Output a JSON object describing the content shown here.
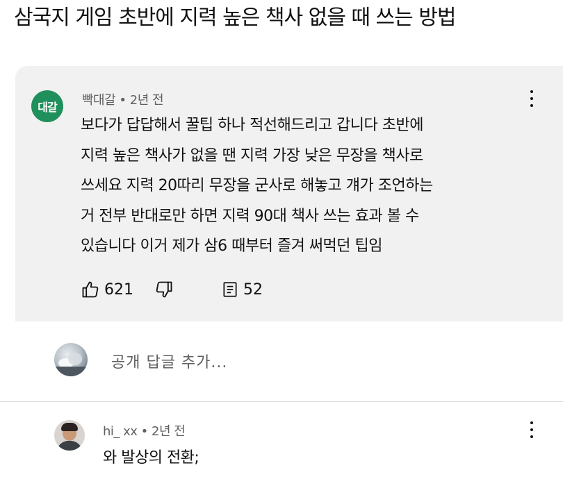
{
  "post": {
    "title": "삼국지 게임 초반에 지력 높은 책사 없을 때 쓰는 방법"
  },
  "comment": {
    "avatar_text": "대갈",
    "author": "빡대갈",
    "separator": " • ",
    "time": "2년 전",
    "body_lines": [
      "보다가 답답해서 꿀팁 하나 적선해드리고 갑니다 초반에",
      "지력 높은 책사가 없을 땐 지력 가장 낮은 무장을 책사로",
      "쓰세요 지력 20따리 무장을 군사로 해놓고 걔가 조언하는",
      "거 전부 반대로만 하면 지력 90대 책사 쓰는 효과 볼 수",
      "있습니다 이거 제가 삼6 때부터 즐겨 써먹던 팁임"
    ],
    "likes": "621",
    "replies": "52",
    "avatar_color": "#1f8f5c"
  },
  "reply_box": {
    "placeholder": "공개 답글 추가..."
  },
  "reply": {
    "author": "hi_ xx",
    "separator": " • ",
    "time": "2년 전",
    "text": "와 발상의 전환;"
  },
  "icons": {
    "like": "thumbs-up-icon",
    "dislike": "thumbs-down-icon",
    "replies": "reply-count-icon",
    "more": "more-vert-icon"
  }
}
